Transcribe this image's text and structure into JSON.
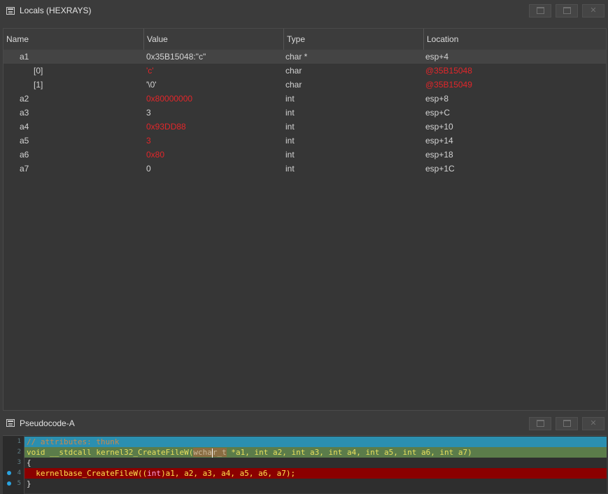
{
  "locals_title": "Locals (HEXRAYS)",
  "pseudo_title": "Pseudocode-A",
  "columns": [
    "Name",
    "Value",
    "Type",
    "Location"
  ],
  "rows": [
    {
      "name": "a1",
      "value": "0x35B15048:\"c\"",
      "type": "char *",
      "location": "esp+4",
      "indent": 0,
      "value_red": false,
      "loc_red": false
    },
    {
      "name": "[0]",
      "value": "'c'",
      "type": "char",
      "location": "@35B15048",
      "indent": 1,
      "value_red": true,
      "loc_red": true
    },
    {
      "name": "[1]",
      "value": "'\\0'",
      "type": "char",
      "location": "@35B15049",
      "indent": 1,
      "value_red": false,
      "loc_red": true
    },
    {
      "name": "a2",
      "value": "0x80000000",
      "type": "int",
      "location": "esp+8",
      "indent": 0,
      "value_red": true,
      "loc_red": false
    },
    {
      "name": "a3",
      "value": "3",
      "type": "int",
      "location": "esp+C",
      "indent": 0,
      "value_red": false,
      "loc_red": false
    },
    {
      "name": "a4",
      "value": "0x93DD88",
      "type": "int",
      "location": "esp+10",
      "indent": 0,
      "value_red": true,
      "loc_red": false
    },
    {
      "name": "a5",
      "value": "3",
      "type": "int",
      "location": "esp+14",
      "indent": 0,
      "value_red": true,
      "loc_red": false
    },
    {
      "name": "a6",
      "value": "0x80",
      "type": "int",
      "location": "esp+18",
      "indent": 0,
      "value_red": true,
      "loc_red": false
    },
    {
      "name": "a7",
      "value": "0",
      "type": "int",
      "location": "esp+1C",
      "indent": 0,
      "value_red": false,
      "loc_red": false
    }
  ],
  "code": {
    "line_numbers": [
      "1",
      "2",
      "3",
      "4",
      "5"
    ],
    "l1": "// attributes: thunk",
    "l2_pre": "void __stdcall kernel32_CreateFileW(",
    "l2_hl_a": "wcha",
    "l2_hl_b": "r_t",
    "l2_post": " *a1, int a2, int a3, int a4, int a5, int a6, int a7)",
    "l3": "{",
    "l4_pre": "  kernelbase_CreateFileW((",
    "l4_cast": "int",
    "l4_post": ")a1, a2, a3, a4, a5, a6, a7);",
    "l5": "}"
  },
  "colors": {
    "accent_red": "#e2262a",
    "breakpoint_line": "#8b0000",
    "current_line": "#5b7c4a",
    "comment_line": "#2b8fb0"
  }
}
